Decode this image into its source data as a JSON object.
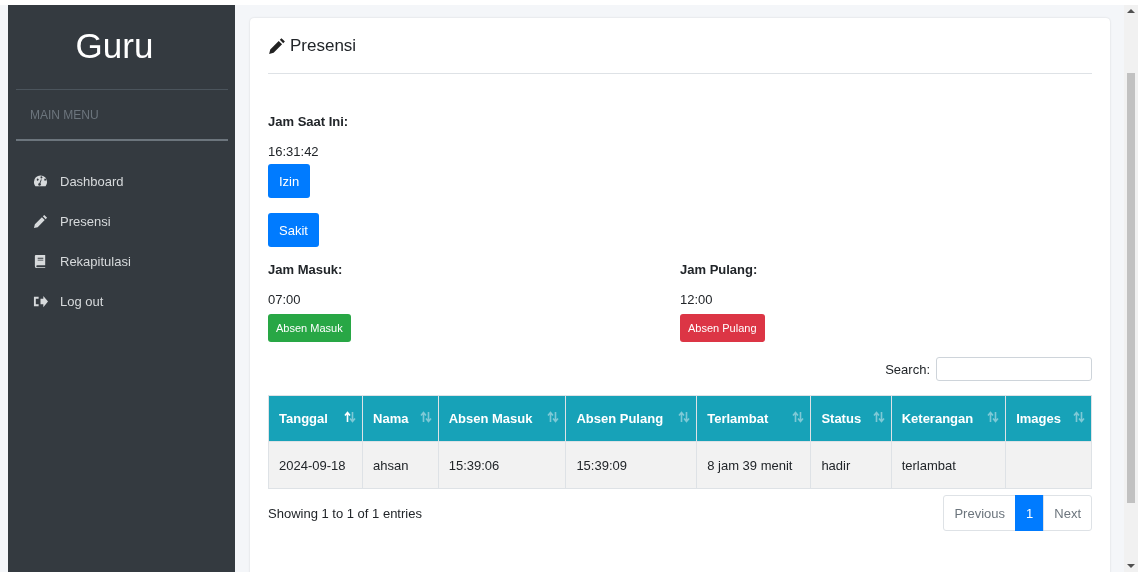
{
  "sidebar": {
    "brand": "Guru",
    "section": "MAIN MENU",
    "items": [
      {
        "label": "Dashboard",
        "selected": false
      },
      {
        "label": "Presensi",
        "selected": false
      },
      {
        "label": "Rekapitulasi",
        "selected": false
      },
      {
        "label": "Log out",
        "selected": false
      }
    ]
  },
  "card": {
    "title": "Presensi",
    "clock": {
      "label": "Jam Saat Ini:",
      "value": "16:31:42"
    },
    "leave_buttons": [
      {
        "label": "Izin"
      },
      {
        "label": "Sakit"
      }
    ],
    "shifts": [
      {
        "label": "Jam Masuk:",
        "value": "07:00",
        "button": "Absen Masuk",
        "kind": "success"
      },
      {
        "label": "Jam Pulang:",
        "value": "12:00",
        "button": "Absen Pulang",
        "kind": "danger"
      }
    ],
    "search": {
      "label": "Search:"
    },
    "table": {
      "columns": [
        {
          "label": "Tanggal",
          "sorted": true
        },
        {
          "label": "Nama",
          "sorted": false
        },
        {
          "label": "Absen Masuk",
          "sorted": false
        },
        {
          "label": "Absen Pulang",
          "sorted": false
        },
        {
          "label": "Terlambat",
          "sorted": false
        },
        {
          "label": "Status",
          "sorted": false
        },
        {
          "label": "Keterangan",
          "sorted": false
        },
        {
          "label": "Images",
          "sorted": false
        }
      ],
      "rows": [
        [
          "2024-09-18",
          "ahsan",
          "15:39:06",
          "15:39:09",
          "8 jam 39 menit",
          "hadir",
          "terlambat",
          null
        ]
      ]
    },
    "info": "Showing 1 to 1 of 1 entries",
    "pagination": [
      {
        "label": "Previous",
        "selected": false,
        "disabled": true
      },
      {
        "label": "1",
        "selected": true,
        "disabled": false
      },
      {
        "label": "Next",
        "selected": false,
        "disabled": true
      }
    ]
  }
}
